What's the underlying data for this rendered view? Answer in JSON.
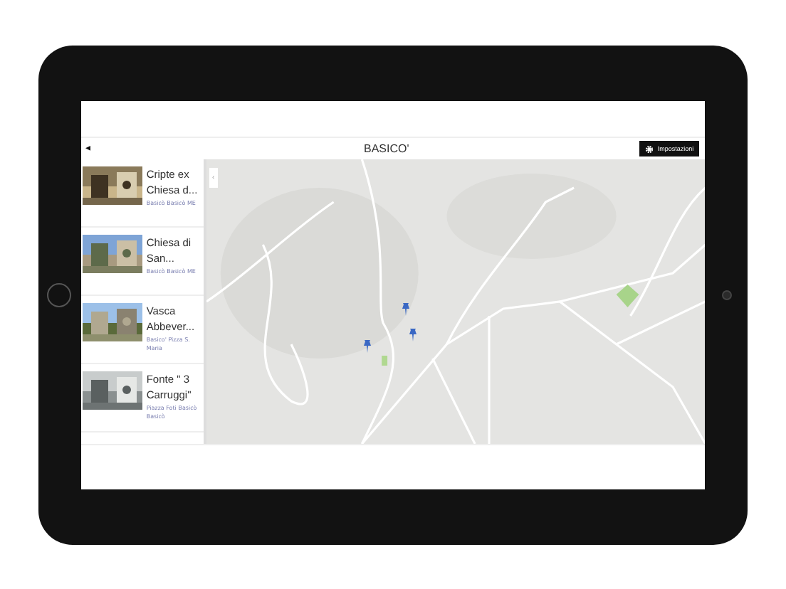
{
  "header": {
    "back": "◂",
    "title": "BASICO'",
    "settings_button": "Impostazioni"
  },
  "places": [
    {
      "title": "Cripte ex Chiesa d...",
      "address": "Basicò Basicò ME",
      "kind": "picture"
    },
    {
      "title": "Chiesa di San...",
      "address": "Basicò Basicò ME",
      "kind": "picture"
    },
    {
      "title": "Vasca Abbever...",
      "address": "Basico' Pizza S. Maria",
      "kind": "picture"
    },
    {
      "title": "Fonte \" 3 Carruggi\"",
      "address": "Piazza Foti Basicò Basicò",
      "kind": "picture"
    }
  ],
  "map": {
    "collapse": "‹",
    "kind": "picture"
  }
}
